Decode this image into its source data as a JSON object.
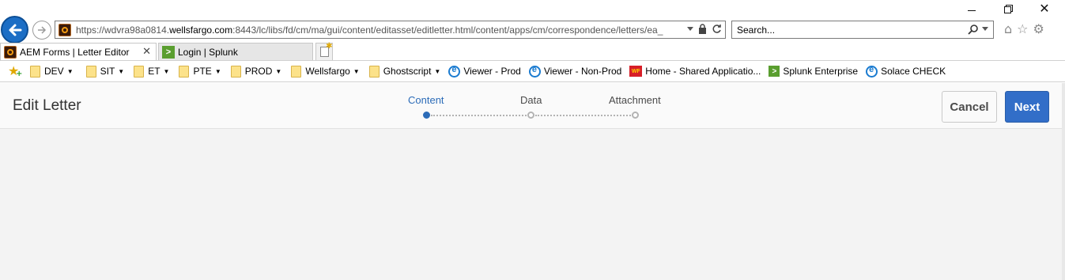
{
  "browser": {
    "address_url_prefix": "https://wdvra98a0814.",
    "address_url_domain": "wellsfargo.com",
    "address_url_rest": ":8443/lc/libs/fd/cm/ma/gui/content/editasset/editletter.html/content/apps/cm/correspondence/letters/ea_",
    "search_placeholder": "Search...",
    "tabs": [
      {
        "label": "AEM Forms | Letter Editor",
        "active": true,
        "icon": "aem-icon"
      },
      {
        "label": "Login | Splunk",
        "active": false,
        "icon": "splunk-icon"
      }
    ],
    "favorites": [
      {
        "label": "DEV",
        "type": "folder"
      },
      {
        "label": "SIT",
        "type": "folder"
      },
      {
        "label": "ET",
        "type": "folder"
      },
      {
        "label": "PTE",
        "type": "folder"
      },
      {
        "label": "PROD",
        "type": "folder"
      },
      {
        "label": "Wellsfargo",
        "type": "folder"
      },
      {
        "label": "Ghostscript",
        "type": "folder"
      },
      {
        "label": "Viewer - Prod",
        "type": "ie"
      },
      {
        "label": "Viewer - Non-Prod",
        "type": "ie"
      },
      {
        "label": "Home - Shared Applicatio...",
        "type": "wf"
      },
      {
        "label": "Splunk Enterprise",
        "type": "splunk"
      },
      {
        "label": "Solace CHECK",
        "type": "ie"
      }
    ],
    "wf_icon_text": "WF",
    "splunk_icon_text": ">"
  },
  "app": {
    "title": "Edit Letter",
    "steps": [
      {
        "label": "Content",
        "current": true
      },
      {
        "label": "Data",
        "current": false
      },
      {
        "label": "Attachment",
        "current": false
      }
    ],
    "cancel_label": "Cancel",
    "next_label": "Next"
  },
  "colors": {
    "accent": "#326ec8",
    "current_step": "#2c6cb8",
    "back_button": "#1c6ec5"
  }
}
